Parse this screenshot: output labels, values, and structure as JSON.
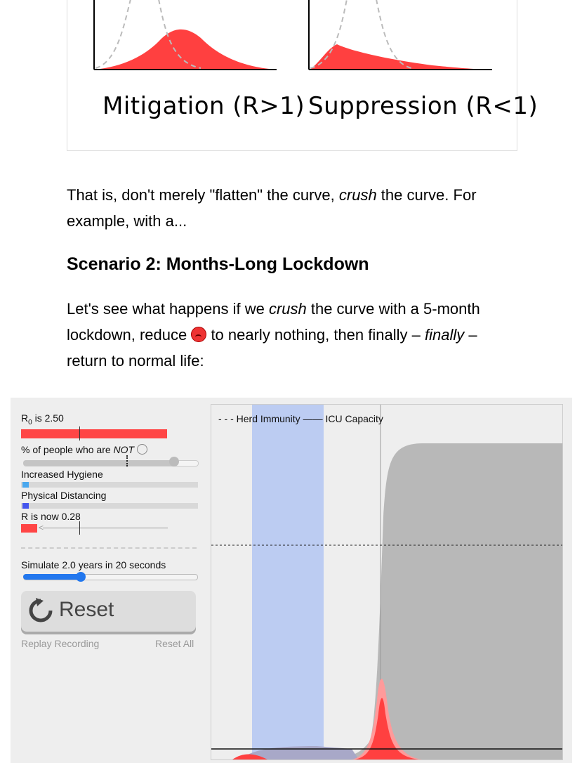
{
  "figure": {
    "captions": [
      "Mitigation (R>1)",
      "Suppression (R<1)"
    ]
  },
  "paragraph1": {
    "before": "That is, don't merely \"flatten\" the curve, ",
    "em": "crush",
    "after": " the curve. For example, with a..."
  },
  "heading": "Scenario 2: Months-Long Lockdown",
  "paragraph2": {
    "part1": "Let's see what happens if we ",
    "em1": "crush",
    "part2": " the curve with a 5-month lockdown, reduce ",
    "part3": " to nearly nothing, then finally – ",
    "em2": "finally",
    "part4": " – return to normal life:"
  },
  "sim": {
    "r0_label": "R",
    "r0_sub": "0",
    "r0_value_text": " is 2.50",
    "not_label_pre": "% of people who are ",
    "not_label_em": "NOT",
    "hygiene_label": "Increased Hygiene",
    "distancing_label": "Physical Distancing",
    "r_now_label": "R is now 0.28",
    "simulate_label": "Simulate 2.0 years in 20 seconds",
    "reset_label": "Reset",
    "replay_label": "Replay Recording",
    "reset_all_label": "Reset All",
    "legend_herd": "- - - Herd Immunity",
    "legend_icu": "—— ICU Capacity",
    "colors": {
      "accent_red": "#ff4545",
      "hygiene": "#4aa8ee",
      "distancing": "#4455ee",
      "lockdown_band": "#bcccf2",
      "recovered": "#b8b8b8",
      "slider_blue": "#2277ee"
    },
    "values": {
      "r0": 2.5,
      "r_now": 0.28,
      "simulate_fraction": 0.33
    }
  }
}
